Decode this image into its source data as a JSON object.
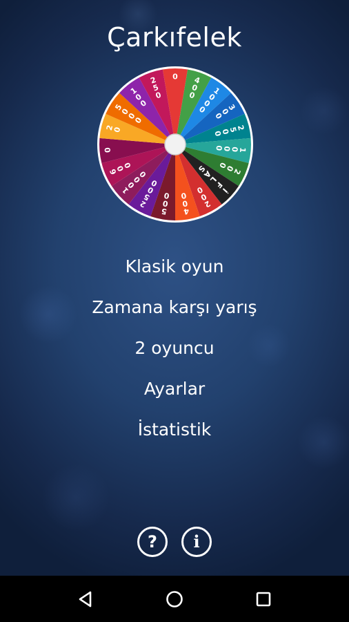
{
  "app": {
    "title": "Çarkıfelek"
  },
  "wheel": {
    "segments": [
      {
        "label": "0",
        "color": "#e53935"
      },
      {
        "label": "400",
        "color": "#43a047"
      },
      {
        "label": "1000",
        "color": "#1e88e5"
      },
      {
        "label": "300",
        "color": "#1565c0"
      },
      {
        "label": "2500",
        "color": "#00838f"
      },
      {
        "label": "1000",
        "color": "#26a69a"
      },
      {
        "label": "200",
        "color": "#2e7d32"
      },
      {
        "label": "İFLAS",
        "color": "#212121"
      },
      {
        "label": "200",
        "color": "#d32f2f"
      },
      {
        "label": "400",
        "color": "#f4511e"
      },
      {
        "label": "500",
        "color": "#7b1a2c"
      },
      {
        "label": "2500",
        "color": "#6a1b9a"
      },
      {
        "label": "1000",
        "color": "#8e1c5c"
      },
      {
        "label": "600",
        "color": "#ad1457"
      },
      {
        "label": "0",
        "color": "#880e4f"
      },
      {
        "label": "20",
        "color": "#f9a825"
      },
      {
        "label": "5000",
        "color": "#ef6c00"
      },
      {
        "label": "100",
        "color": "#8e24aa"
      },
      {
        "label": "250",
        "color": "#c2185b"
      }
    ]
  },
  "menu": {
    "items": [
      {
        "label": "Klasik oyun"
      },
      {
        "label": "Zamana karşı yarış"
      },
      {
        "label": "2 oyuncu"
      },
      {
        "label": "Ayarlar"
      },
      {
        "label": "İstatistik"
      }
    ]
  },
  "footer": {
    "help_glyph": "?",
    "info_glyph": "i"
  },
  "navbar": {
    "icons": [
      "back-icon",
      "home-icon",
      "recents-icon"
    ]
  }
}
